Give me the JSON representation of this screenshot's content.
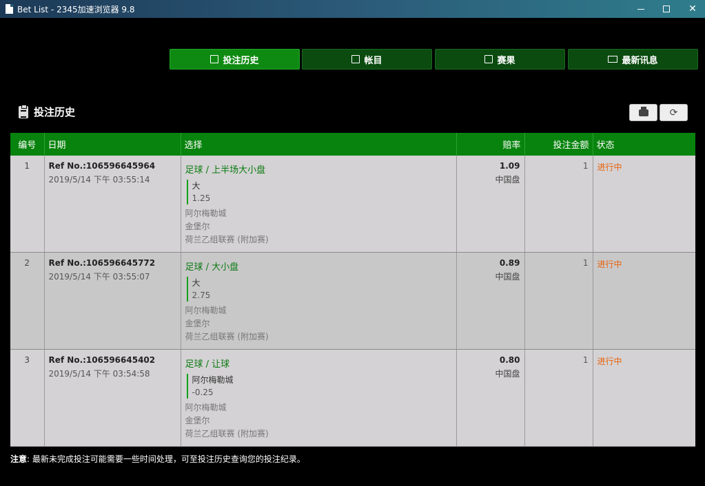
{
  "window": {
    "title": "Bet List - 2345加速浏览器 9.8"
  },
  "nav": {
    "tabs": [
      {
        "label": "投注历史",
        "icon": "receipt-icon"
      },
      {
        "label": "帐目",
        "icon": "ledger-icon"
      },
      {
        "label": "赛果",
        "icon": "results-icon"
      },
      {
        "label": "最新讯息",
        "icon": "mail-icon"
      }
    ]
  },
  "section": {
    "title": "投注历史"
  },
  "table": {
    "headers": [
      "编号",
      "日期",
      "选择",
      "赔率",
      "投注金额",
      "状态"
    ],
    "rows": [
      {
        "no": "1",
        "ref": "Ref No.:106596645964",
        "date": "2019/5/14 下午 03:55:14",
        "sel_title": "足球 / 上半场大小盘",
        "pick": "大",
        "line": "1.25",
        "team1": "阿尔梅勒城",
        "team2": "金堡尔",
        "league": "荷兰乙组联赛 (附加赛)",
        "odds": "1.09",
        "odds_type": "中国盘",
        "amount": "1",
        "status": "进行中"
      },
      {
        "no": "2",
        "ref": "Ref No.:106596645772",
        "date": "2019/5/14 下午 03:55:07",
        "sel_title": "足球 / 大小盘",
        "pick": "大",
        "line": "2.75",
        "team1": "阿尔梅勒城",
        "team2": "金堡尔",
        "league": "荷兰乙组联赛 (附加赛)",
        "odds": "0.89",
        "odds_type": "中国盘",
        "amount": "1",
        "status": "进行中"
      },
      {
        "no": "3",
        "ref": "Ref No.:106596645402",
        "date": "2019/5/14 下午 03:54:58",
        "sel_title": "足球 / 让球",
        "pick": "阿尔梅勒城",
        "line": "-0.25",
        "team1": "阿尔梅勒城",
        "team2": "金堡尔",
        "league": "荷兰乙组联赛 (附加赛)",
        "odds": "0.80",
        "odds_type": "中国盘",
        "amount": "1",
        "status": "进行中"
      }
    ]
  },
  "note": {
    "label": "注意",
    "text": ": 最新未完成投注可能需要一些时间处理，可至投注历史查询您的投注纪录。"
  },
  "colors": {
    "accent": "#08830d",
    "status": "#e8620a"
  }
}
